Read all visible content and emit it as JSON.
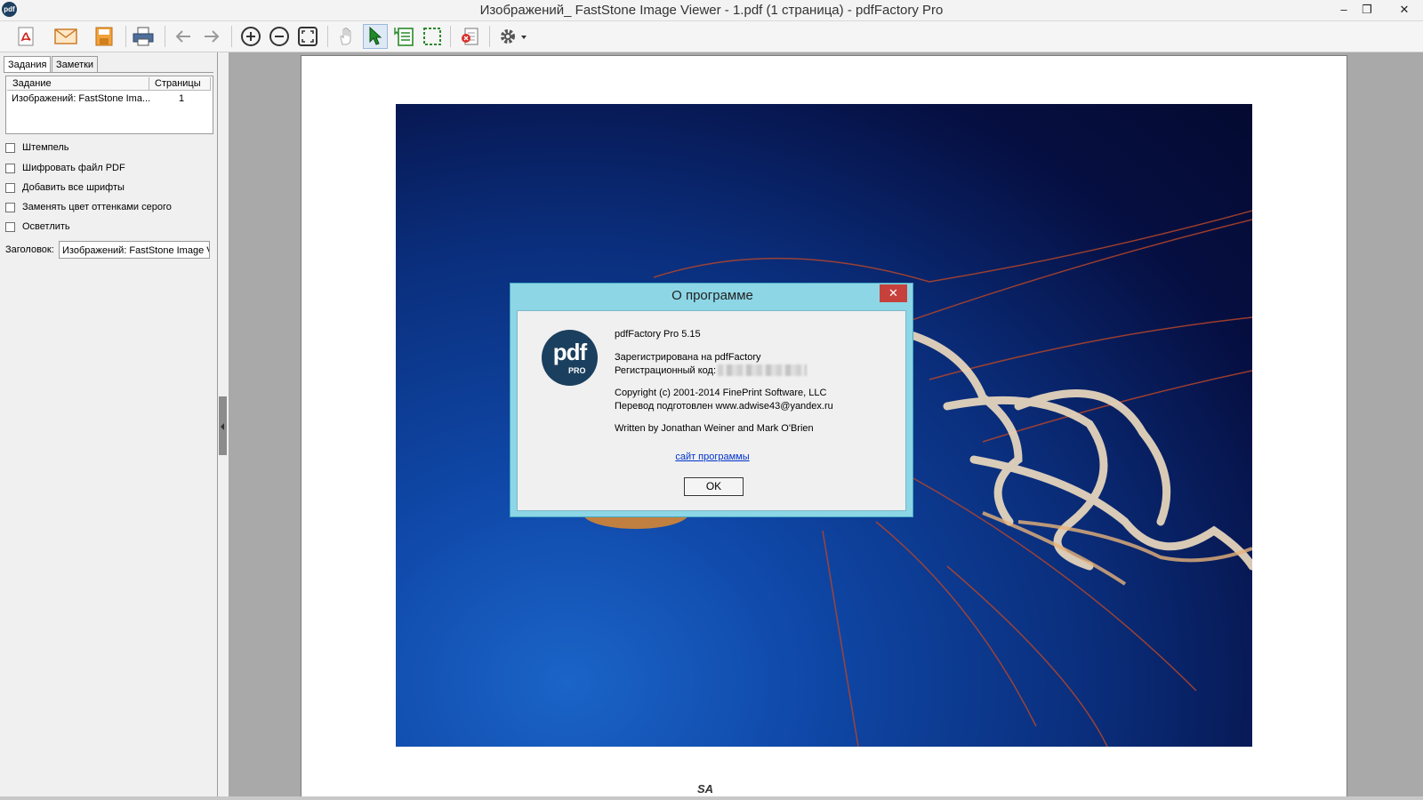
{
  "window": {
    "title": "Изображений_ FastStone Image Viewer - 1.pdf (1 страница) - pdfFactory Pro",
    "app_icon_text": "pdf",
    "controls": {
      "minimize": "–",
      "restore": "❐",
      "close": "✕"
    }
  },
  "toolbar": {
    "buttons": [
      {
        "name": "save-pdf-icon"
      },
      {
        "name": "email-icon"
      },
      {
        "name": "save-icon"
      },
      {
        "name": "print-icon"
      },
      {
        "name": "back-arrow-icon"
      },
      {
        "name": "forward-arrow-icon"
      },
      {
        "name": "zoom-in-icon"
      },
      {
        "name": "zoom-out-icon"
      },
      {
        "name": "fit-page-icon"
      },
      {
        "name": "hand-icon"
      },
      {
        "name": "select-pointer-icon"
      },
      {
        "name": "text-select-icon"
      },
      {
        "name": "marquee-select-icon"
      },
      {
        "name": "delete-page-icon"
      },
      {
        "name": "settings-gear-icon"
      }
    ]
  },
  "sidebar": {
    "tabs": [
      {
        "label": "Задания"
      },
      {
        "label": "Заметки"
      }
    ],
    "table": {
      "headers": [
        "Задание",
        "Страницы"
      ],
      "rows": [
        {
          "job": "Изображений: FastStone Ima...",
          "pages": "1"
        }
      ]
    },
    "options": [
      {
        "label": "Штемпель",
        "checked": false
      },
      {
        "label": "Шифровать файл PDF",
        "checked": false
      },
      {
        "label": "Добавить все шрифты",
        "checked": false
      },
      {
        "label": "Заменять цвет оттенками серого",
        "checked": false
      },
      {
        "label": "Осветлить",
        "checked": false
      }
    ],
    "header_label": "Заголовок:",
    "header_value": "Изображений: FastStone Image V"
  },
  "viewer": {
    "page_mark": "SA"
  },
  "dialog": {
    "title": "О программе",
    "close": "✕",
    "logo": {
      "main": "pdf",
      "sub": "PRO"
    },
    "product": "pdfFactory Pro 5.15",
    "registered": "Зарегистрирована на pdfFactory",
    "reg_code_label": "Регистрационный код:",
    "copyright": "Copyright (c) 2001-2014 FinePrint Software, LLC",
    "translation": "Перевод подготовлен www.adwise43@yandex.ru",
    "authors": "Written by Jonathan Weiner and Mark O'Brien",
    "site_link": "сайт программы",
    "ok": "OK"
  },
  "colors": {
    "dialog_frame": "#8cd6e6",
    "dialog_close": "#c7413c",
    "logo_bg": "#1b3f5e",
    "link": "#0033cc"
  }
}
